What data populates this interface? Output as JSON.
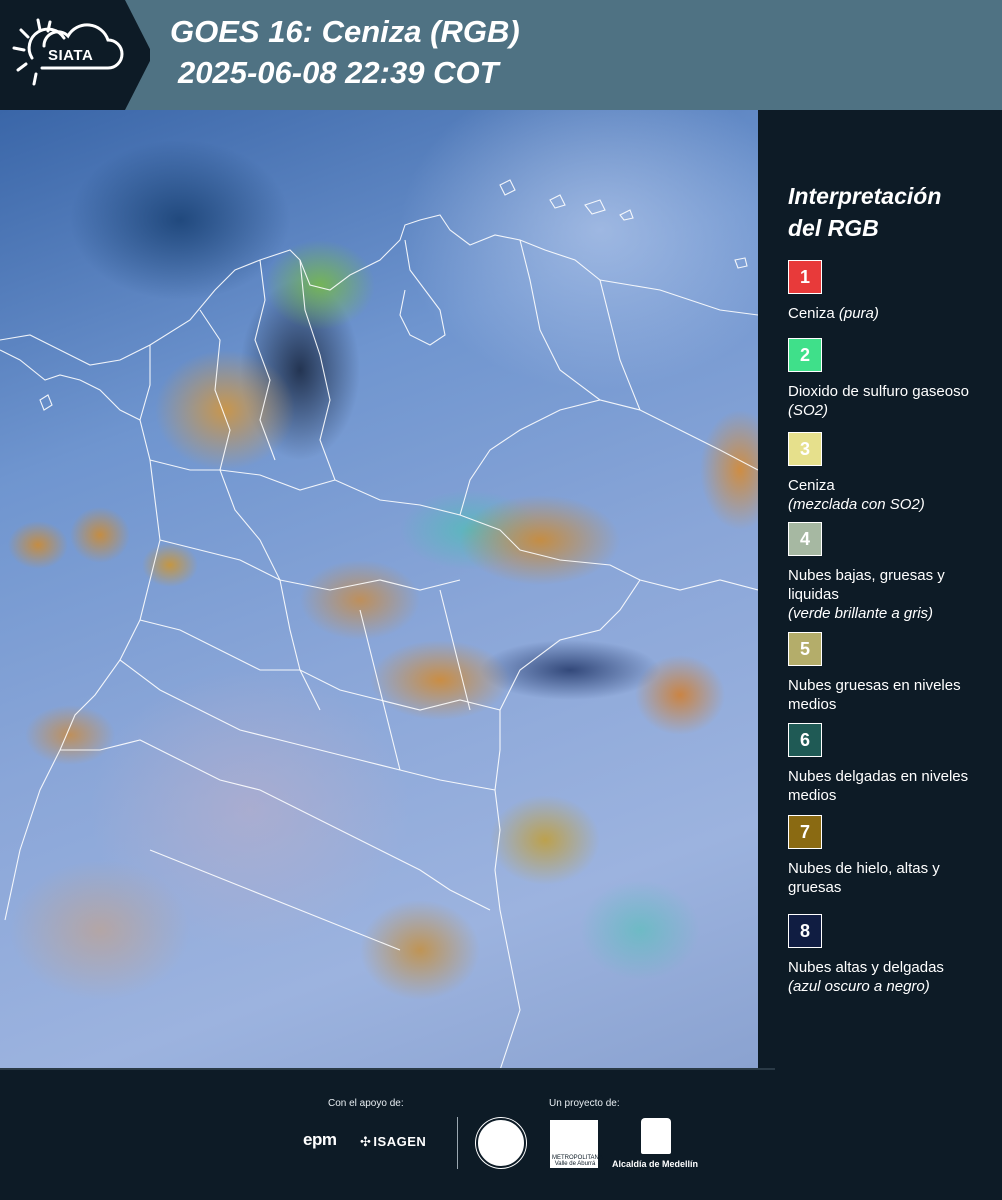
{
  "header": {
    "logo_text": "SIATA",
    "title_line1": "GOES 16: Ceniza (RGB)",
    "title_line2": "2025-06-08 22:39 COT"
  },
  "legend": {
    "title": "Interpretación\ndel RGB",
    "items": [
      {
        "num": "1",
        "color": "#e83a3a",
        "label": "Ceniza ",
        "note": "(pura)"
      },
      {
        "num": "2",
        "color": "#3fe08a",
        "label": "Dioxido de sulfuro gaseoso ",
        "note": "(SO2)"
      },
      {
        "num": "3",
        "color": "#e6e08c",
        "label": "Ceniza",
        "note": "(mezclada con SO2)"
      },
      {
        "num": "4",
        "color": "#a6b8a2",
        "label": "Nubes bajas, gruesas y liquidas",
        "note": "(verde brillante a gris)"
      },
      {
        "num": "5",
        "color": "#b4ad6a",
        "label": "Nubes gruesas en niveles medios",
        "note": ""
      },
      {
        "num": "6",
        "color": "#1f5a55",
        "label": "Nubes delgadas en niveles medios",
        "note": ""
      },
      {
        "num": "7",
        "color": "#8a6a12",
        "label": "Nubes de hielo, altas y gruesas",
        "note": ""
      },
      {
        "num": "8",
        "color": "#101d42",
        "label": "Nubes altas y delgadas",
        "note": "(azul oscuro a negro)"
      }
    ]
  },
  "footer": {
    "support_label": "Con el apoyo de:",
    "project_label": "Un proyecto de:",
    "sponsor1": "epm",
    "sponsor2": "ISAGEN",
    "area_text": "METROPOLITANA Valle de Aburrá",
    "alcaldia_text": "Alcaldía de Medellín"
  }
}
